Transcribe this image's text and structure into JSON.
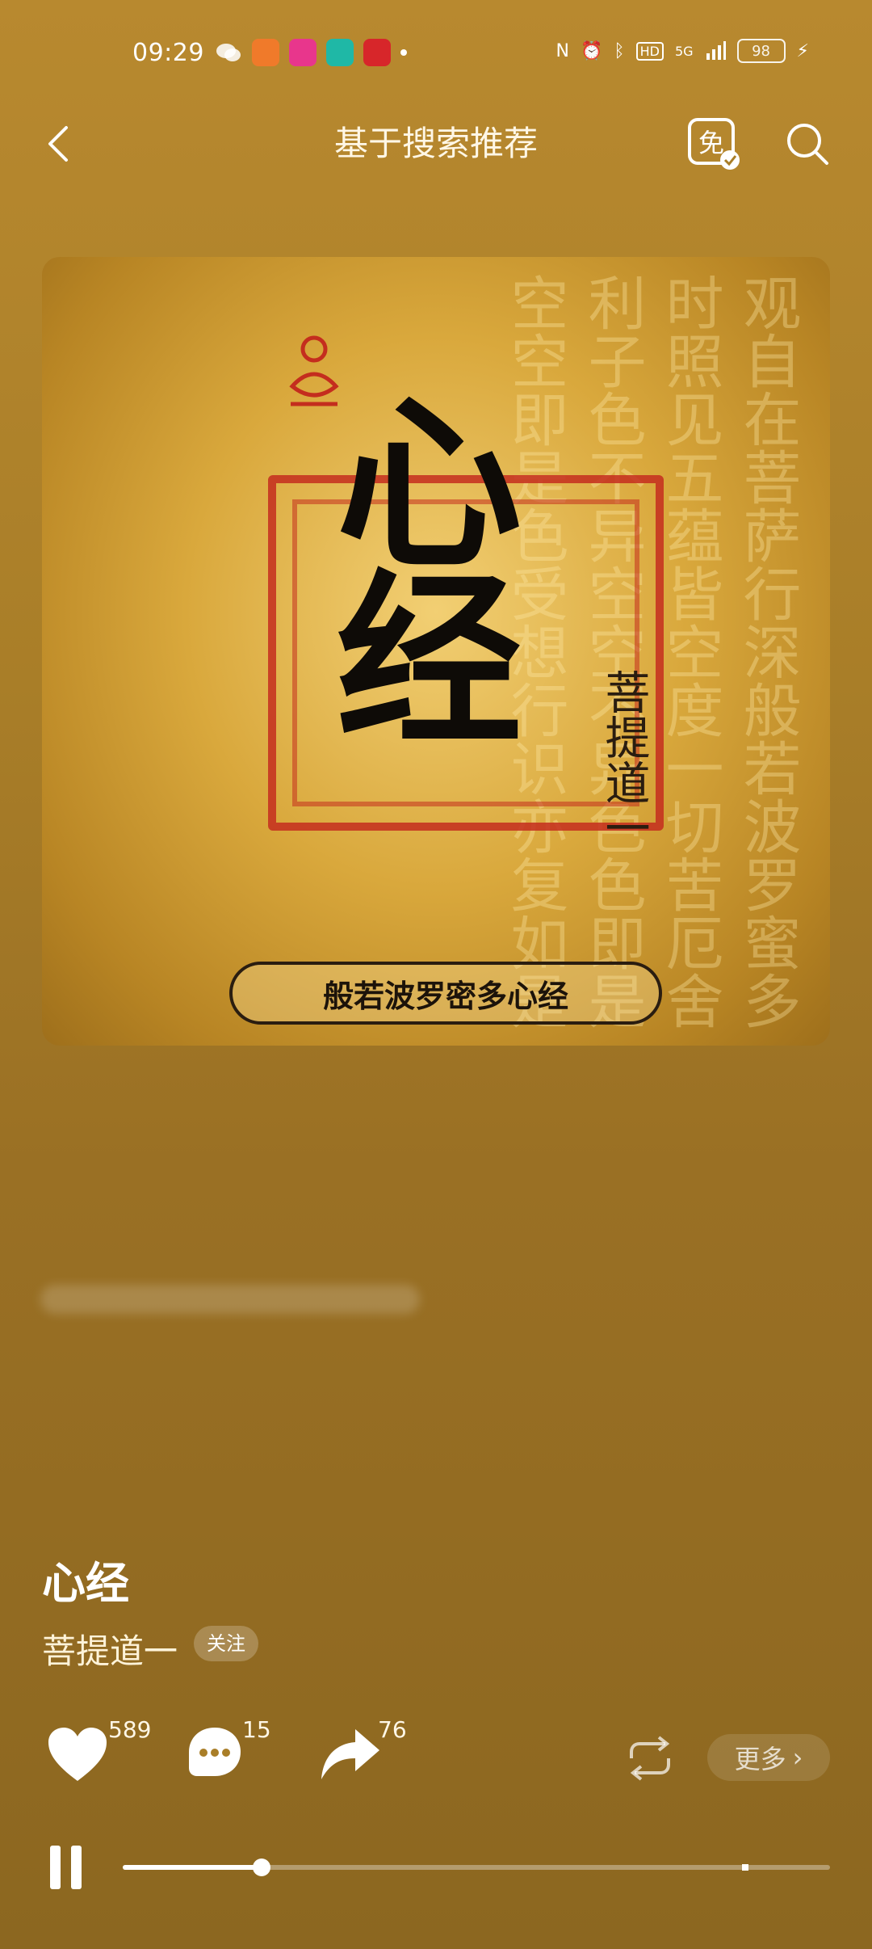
{
  "status_bar": {
    "time": "09:29",
    "battery": "98",
    "network": "5G"
  },
  "header": {
    "title": "基于搜索推荐"
  },
  "cover": {
    "title": "心经",
    "author": "菩提道一",
    "banner": "般若波罗密多心经",
    "background_text": "观自在菩萨行深般若波罗蜜多时照见五蕴皆空度一切苦厄舍利子色不异空空不异色色即是空空即是色受想行识亦复如是"
  },
  "song": {
    "title": "心经",
    "artist": "菩提道一",
    "follow_label": "关注"
  },
  "actions": {
    "like_count": "589",
    "comment_count": "15",
    "share_count": "76",
    "more_label": "更多"
  },
  "player": {
    "progress": 0.196,
    "buffered": 0.875
  },
  "colors": {
    "background": "#A97E28",
    "seal": "#C42D1E"
  }
}
